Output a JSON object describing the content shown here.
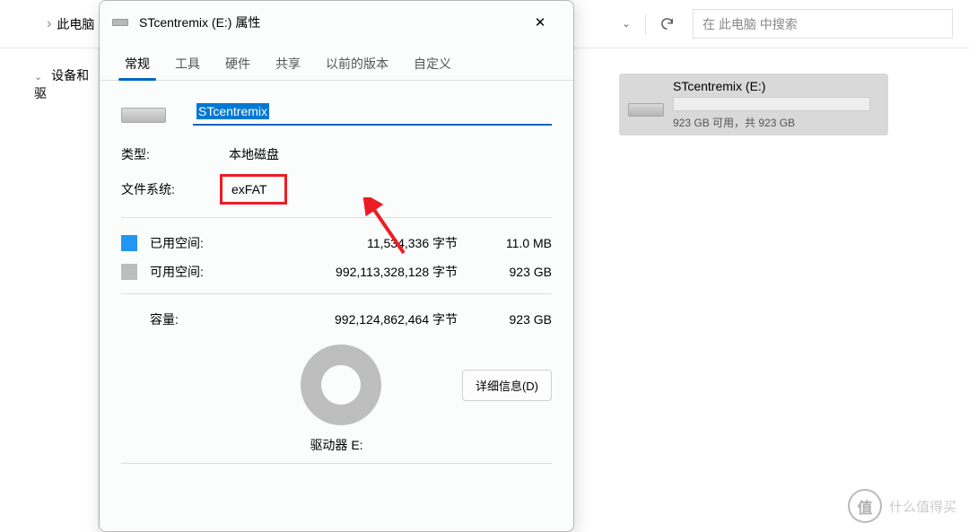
{
  "breadcrumb": {
    "item": "此电脑",
    "chevron": "›"
  },
  "sidebar": {
    "item": "设备和驱"
  },
  "refresh": {
    "dropdown": "⌄",
    "icon": "↻"
  },
  "search": {
    "placeholder": "在 此电脑 中搜索"
  },
  "drive_card": {
    "name": "STcentremix (E:)",
    "free": "923 GB 可用，共 923 GB"
  },
  "dialog": {
    "title": "STcentremix (E:) 属性",
    "close": "✕",
    "tabs": [
      "常规",
      "工具",
      "硬件",
      "共享",
      "以前的版本",
      "自定义"
    ],
    "name_input": "STcentremix",
    "type_label": "类型:",
    "type_value": "本地磁盘",
    "fs_label": "文件系统:",
    "fs_value": "exFAT",
    "used_label": "已用空间:",
    "used_bytes": "11,534,336 字节",
    "used_size": "11.0 MB",
    "free_label": "可用空间:",
    "free_bytes": "992,113,328,128 字节",
    "free_size": "923 GB",
    "cap_label": "容量:",
    "cap_bytes": "992,124,862,464 字节",
    "cap_size": "923 GB",
    "drive_letter": "驱动器 E:",
    "detail_btn": "详细信息(D)"
  },
  "watermark": {
    "badge": "值",
    "text": "什么值得买"
  }
}
